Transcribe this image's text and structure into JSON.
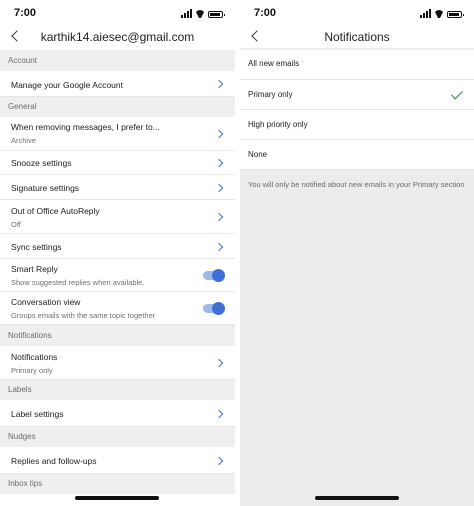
{
  "left": {
    "status": {
      "time": "7:00"
    },
    "header": {
      "title": "karthik14.aiesec@gmail.com"
    },
    "sections": {
      "account": "Account",
      "general": "General",
      "notifications": "Notifications",
      "labels": "Labels",
      "nudges": "Nudges",
      "inbox_tips": "Inbox tips"
    },
    "rows": {
      "manage_account": {
        "title": "Manage your Google Account"
      },
      "removing_messages": {
        "title": "When removing messages, I prefer to...",
        "value": "Archive"
      },
      "snooze": {
        "title": "Snooze settings"
      },
      "signature": {
        "title": "Signature settings"
      },
      "out_of_office": {
        "title": "Out of Office AutoReply",
        "value": "Off"
      },
      "sync": {
        "title": "Sync settings"
      },
      "smart_reply": {
        "title": "Smart Reply",
        "subtitle": "Show suggested replies when available.",
        "enabled": true
      },
      "conversation_view": {
        "title": "Conversation view",
        "subtitle": "Groups emails with the same topic together",
        "enabled": true
      },
      "notifications": {
        "title": "Notifications",
        "value": "Primary only"
      },
      "label_settings": {
        "title": "Label settings"
      },
      "replies_followups": {
        "title": "Replies and follow-ups"
      }
    },
    "icons": {
      "back": "chevron-left-icon",
      "chevron": "chevron-right-icon"
    },
    "colors": {
      "accent": "#3f6fd6"
    }
  },
  "right": {
    "status": {
      "time": "7:00"
    },
    "header": {
      "title": "Notifications"
    },
    "options": [
      {
        "label": "All new emails",
        "selected": false
      },
      {
        "label": "Primary only",
        "selected": true
      },
      {
        "label": "High priority only",
        "selected": false
      },
      {
        "label": "None",
        "selected": false
      }
    ],
    "info_text": "You will only be notified about new emails in your Primary section",
    "icons": {
      "back": "chevron-left-icon",
      "selected": "checkmark-icon"
    },
    "colors": {
      "check": "#1e8e3e"
    }
  }
}
